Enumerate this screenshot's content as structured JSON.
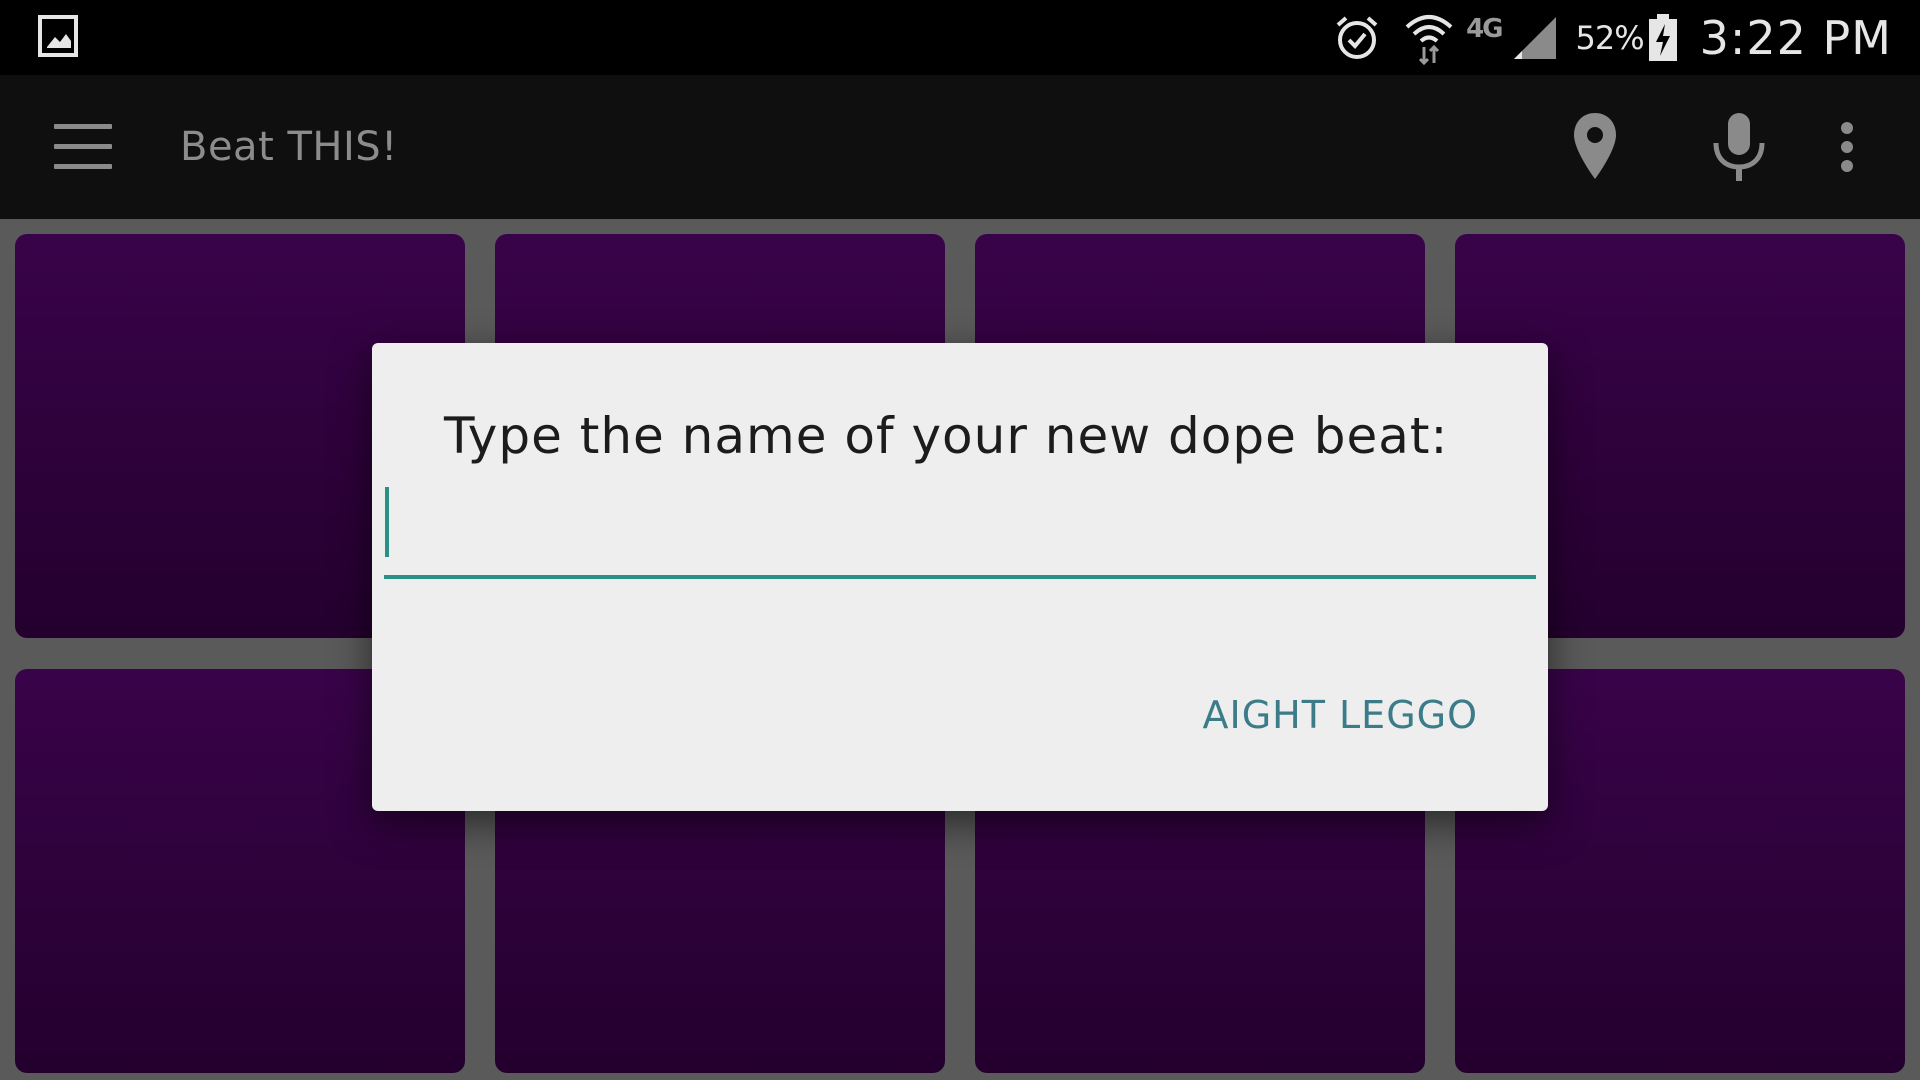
{
  "status_bar": {
    "battery_percent": "52%",
    "time": "3:22 PM",
    "network_type": "4G",
    "icons": [
      "gallery-icon",
      "alarm-icon",
      "wifi-icon",
      "signal-icon",
      "battery-charging-icon"
    ]
  },
  "app_bar": {
    "title": "Beat THIS!",
    "icons": [
      "menu-icon",
      "location-icon",
      "microphone-icon",
      "overflow-menu-icon"
    ]
  },
  "pads": {
    "rows": 2,
    "columns": 4,
    "color": "#390349"
  },
  "dialog": {
    "title": "Type the name of your new dope beat:",
    "input_value": "",
    "input_placeholder": "",
    "confirm_label": "AIGHT LEGGO",
    "accent_color": "#2a9187",
    "button_color": "#3b7c88"
  }
}
